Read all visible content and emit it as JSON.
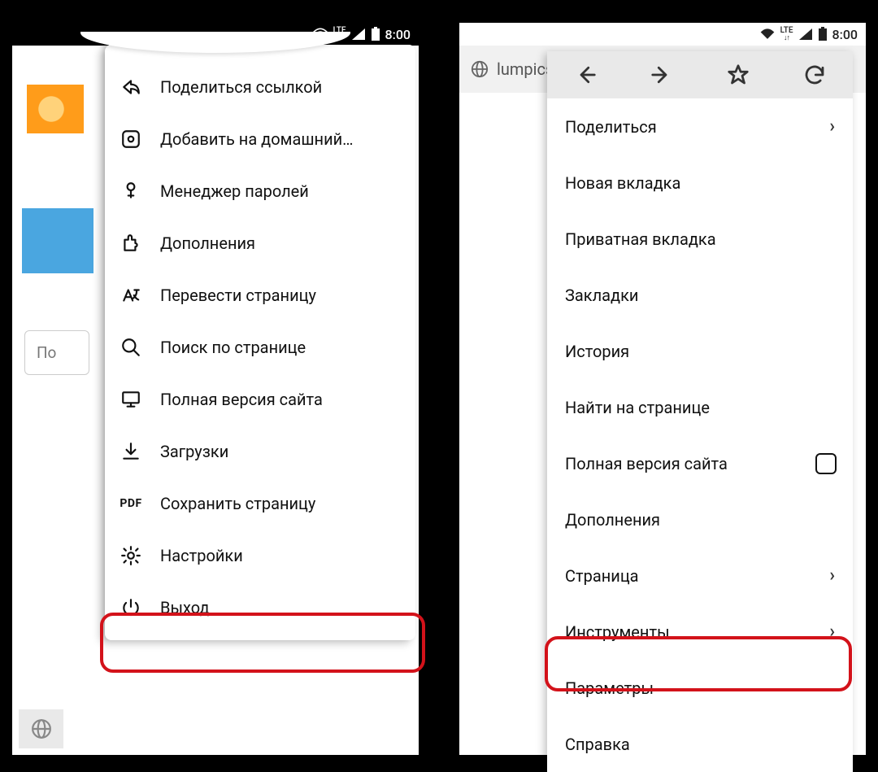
{
  "statusbar": {
    "time": "8:00",
    "lte": "LTE"
  },
  "left": {
    "search_placeholder": "По",
    "menu": {
      "share": "Поделиться ссылкой",
      "addhome": "Добавить на домашний…",
      "passmgr": "Менеджер паролей",
      "addons": "Дополнения",
      "translate": "Перевести страницу",
      "findpage": "Поиск по странице",
      "desktop": "Полная версия сайта",
      "downloads": "Загрузки",
      "pdf_icon": "PDF",
      "savepage": "Сохранить страницу",
      "settings": "Настройки",
      "exit": "Выход"
    }
  },
  "right": {
    "url": "lumpics.",
    "menu": {
      "share": "Поделиться",
      "newtab": "Новая вкладка",
      "private": "Приватная вкладка",
      "bookmarks": "Закладки",
      "history": "История",
      "findpage": "Найти на странице",
      "desktop": "Полная версия сайта",
      "addons": "Дополнения",
      "page": "Страница",
      "tools": "Инструменты",
      "params": "Параметры",
      "help": "Справка"
    }
  }
}
